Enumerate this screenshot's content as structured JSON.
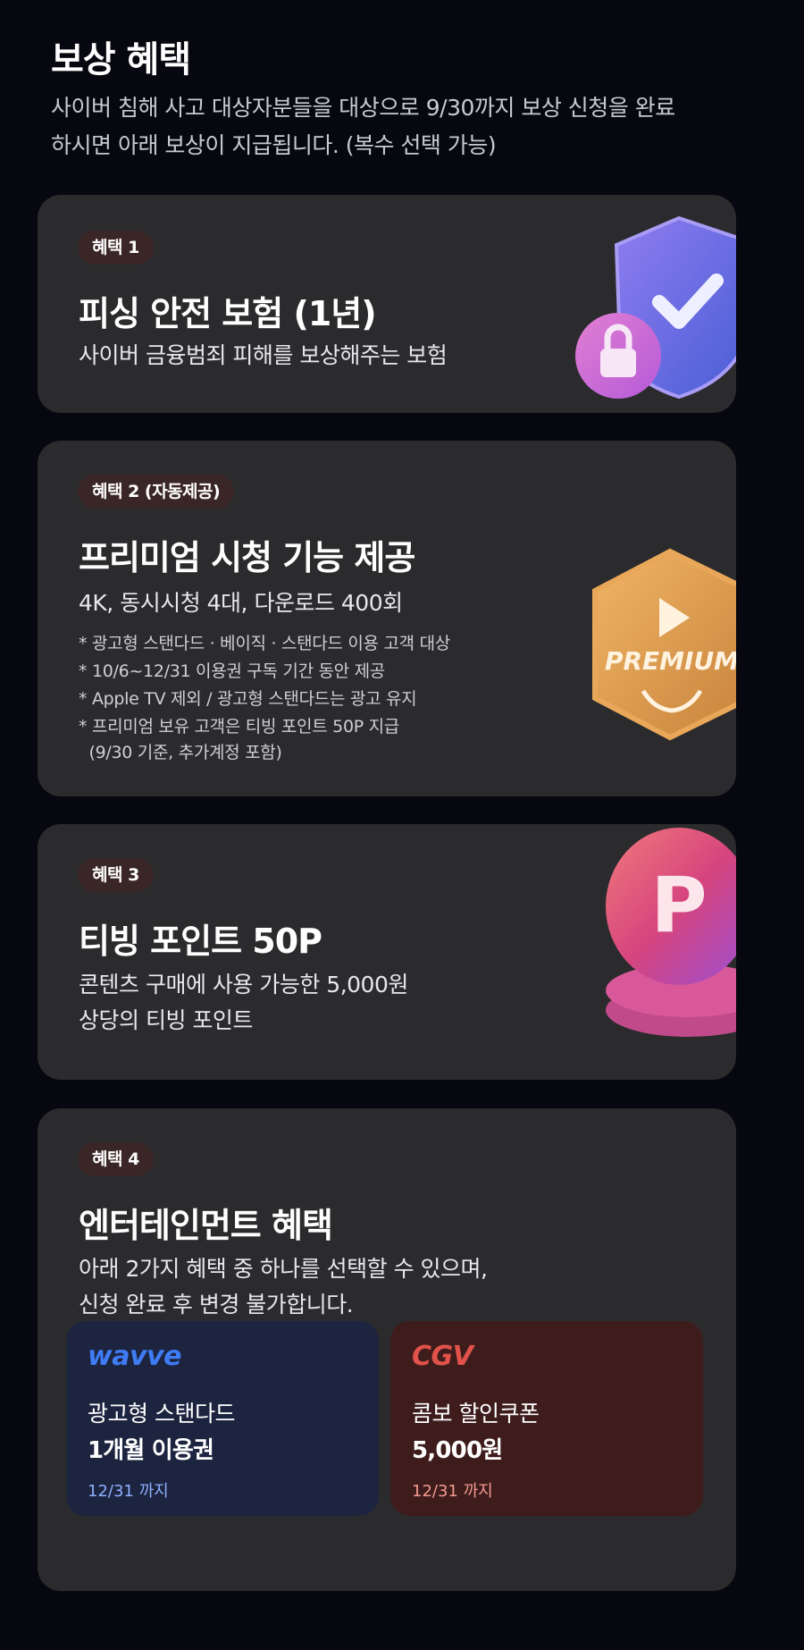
{
  "header": {
    "title": "보상 혜택",
    "intro_line1": "사이버 침해 사고 대상자분들을 대상으로 9/30까지 보상 신청을 완료",
    "intro_line2": "하시면 아래 보상이 지급됩니다. (복수 선택 가능)"
  },
  "benefits": [
    {
      "badge": "혜택 1",
      "title": "피싱 안전 보험 (1년)",
      "desc_lines": [
        "사이버 금융범죄 피해를 보상해주는 보험"
      ],
      "icon": "shield-lock-icon"
    },
    {
      "badge": "혜택 2 (자동제공)",
      "title": "프리미엄 시청 기능 제공",
      "desc_lines": [
        "4K, 동시시청 4대, 다운로드 400회"
      ],
      "notes": [
        "* 광고형 스탠다드 · 베이직 · 스탠다드 이용 고객 대상",
        "* 10/6~12/31 이용권 구독 기간 동안 제공",
        "* Apple TV 제외 / 광고형 스탠다드는 광고 유지",
        "* 프리미엄 보유 고객은 티빙 포인트 50P 지급",
        "  (9/30 기준, 추가계정 포함)"
      ],
      "icon": "premium-badge-icon",
      "icon_text": "PREMIUM"
    },
    {
      "badge": "혜택 3",
      "title": "티빙 포인트 50P",
      "desc_lines": [
        "콘텐츠 구매에 사용 가능한 5,000원",
        "상당의 티빙 포인트"
      ],
      "icon": "point-coin-icon",
      "icon_text": "P"
    },
    {
      "badge": "혜택 4",
      "title": "엔터테인먼트 혜택",
      "desc_lines": [
        "아래 2가지 혜택 중 하나를 선택할 수 있으며,",
        "신청 완료 후 변경 불가합니다."
      ],
      "options": [
        {
          "logo": "wavve",
          "line1": "광고형 스탠다드",
          "line2": "1개월 이용권",
          "date": "12/31 까지",
          "bg_color": "#1c2440",
          "logo_color": "#3f7cf4",
          "date_color": "#8fb0ff"
        },
        {
          "logo": "CGV",
          "line1": "콤보 할인쿠폰",
          "line2": "5,000원",
          "date": "12/31 까지",
          "bg_color": "#3e1c1c",
          "logo_color": "#e0524a",
          "date_color": "#f39a90"
        }
      ]
    }
  ],
  "colors": {
    "background": "#07070f",
    "card": "#2b2b2d",
    "badge": "#3a2527"
  }
}
